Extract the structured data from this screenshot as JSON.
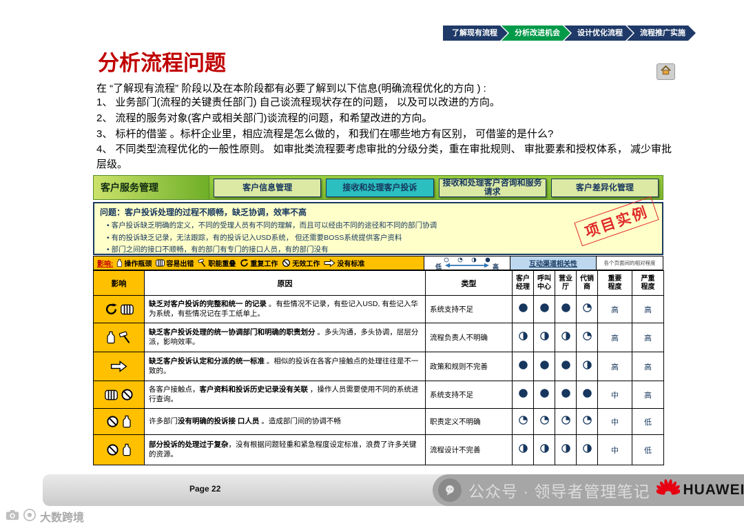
{
  "nav": {
    "steps": [
      {
        "label": "了解现有流程",
        "active": false
      },
      {
        "label": "分析改进机会",
        "active": true
      },
      {
        "label": "设计优化流程",
        "active": false
      },
      {
        "label": "流程推广实施",
        "active": false
      }
    ]
  },
  "title": "分析流程问题",
  "intro": "在 “了解现有流程” 阶段以及在本阶段都有必要了解到以下信息(明确流程优化的方向 )    :",
  "points": [
    "1、  业务部门(流程的关键责任部门)  自己谈流程现状存在的问题，  以及可以改进的方向。",
    "2、  流程的服务对象(客户或相关部门)谈流程的问题，和希望改进的方向。",
    "3、  标杆的借鉴 。标杆企业里，相应流程是怎么做的，  和我们在哪些地方有区别，  可借鉴的是什么?",
    "4、  不同类型流程优化的一般性原则。 如审批类流程要考虑审批的分级分类，重在审批规则、 审批要素和授权体系， 减少审批层级。"
  ],
  "process_bar": {
    "category": "客户服务管理",
    "items": [
      {
        "label": "客户信息管理",
        "highlighted": false
      },
      {
        "label": "接收和处理客户投诉",
        "highlighted": true
      },
      {
        "label": "接收和处理客户咨询和服务请求",
        "highlighted": false
      },
      {
        "label": "客户差异化管理",
        "highlighted": false
      }
    ]
  },
  "problem_box": {
    "title": "问题：客户投诉处理的过程不顺畅，缺乏协调，效率不高",
    "bullets": [
      "客户投诉缺乏明确的定义，不同的受理人员有不同的理解，而且可以经由不同的途径和不同的部门协调",
      "有的投诉缺乏记录，无法跟踪，有的投诉记入USD系统， 但还需要BOSS系统提供客户资料",
      "部门之间的接口不顺畅，有的部门有专门的接口人员，有的部门没有"
    ],
    "stamp": "项目实例"
  },
  "legend": {
    "prefix": "影响:",
    "items": [
      {
        "icon": "bottleneck-icon",
        "label": "操作瓶颈"
      },
      {
        "icon": "error-icon",
        "label": "容易出错"
      },
      {
        "icon": "overlap-icon",
        "label": "职能重叠"
      },
      {
        "icon": "rework-icon",
        "label": "重复工作"
      },
      {
        "icon": "invalid-icon",
        "label": "无效工作"
      },
      {
        "icon": "nostandard-icon",
        "label": "没有标准"
      }
    ],
    "scale_low": "低",
    "scale_high": "高",
    "scale_circles": [
      "empty",
      "quarter",
      "half",
      "full"
    ],
    "scale_note": "各个页面间的相对程度"
  },
  "table": {
    "headers": {
      "impact": "影响",
      "reason": "原因",
      "type": "类型",
      "channel_group": "互动渠道相关性",
      "channels": [
        "客户经理",
        "呼叫中心",
        "营业厅",
        "代销商"
      ],
      "importance": "重要程度",
      "severity": "严重程度"
    },
    "rows": [
      {
        "icons": [
          "rework-icon",
          "error-icon"
        ],
        "reason": [
          {
            "t": "缺乏对客户投诉的完整和统一 的记录 ",
            "b": true
          },
          {
            "t": "。有些情况不记录，有些记入USD, 有些记入华为系统，有些情况记在手工纸单上。",
            "b": false
          }
        ],
        "type": "系统支持不足",
        "channels": [
          "full",
          "full",
          "full",
          "quarter"
        ],
        "importance": "高",
        "severity": "高"
      },
      {
        "icons": [
          "bottleneck-icon",
          "overlap-icon"
        ],
        "reason": [
          {
            "t": "缺乏客户投诉处理的统一协调部门和明确的职责划分 ",
            "b": true
          },
          {
            "t": "。多头沟通，多头协调，层层分派，影响效率。",
            "b": false
          }
        ],
        "type": "流程负责人不明确",
        "channels": [
          "half",
          "half",
          "half",
          "quarter"
        ],
        "importance": "高",
        "severity": "高"
      },
      {
        "icons": [
          "nostandard-icon"
        ],
        "reason": [
          {
            "t": "缺乏客户投诉认定和分派的统一标准 ",
            "b": true
          },
          {
            "t": "。相似的投诉在各客户接触点的处理往往是不一致的。",
            "b": false
          }
        ],
        "type": "政策和规则不完善",
        "channels": [
          "full",
          "full",
          "full",
          "half"
        ],
        "importance": "高",
        "severity": "高"
      },
      {
        "icons": [
          "error-icon",
          "invalid-icon"
        ],
        "reason": [
          {
            "t": "各客户接触点，",
            "b": false
          },
          {
            "t": "客户资料和投诉历史记录没有关联 ",
            "b": true
          },
          {
            "t": "，操作人员需要使用不同的系统进行查询。",
            "b": false
          }
        ],
        "type": "系统支持不足",
        "channels": [
          "full",
          "full",
          "full",
          "full"
        ],
        "importance": "中",
        "severity": "高"
      },
      {
        "icons": [
          "invalid-icon",
          "bottleneck-icon"
        ],
        "reason": [
          {
            "t": "许多部门",
            "b": false
          },
          {
            "t": "没有明确的投诉接 口人员 ",
            "b": true
          },
          {
            "t": "。造成部门间的协调不畅",
            "b": false
          }
        ],
        "type": "职责定义不明确",
        "channels": [
          "quarter",
          "quarter",
          "quarter",
          "quarter"
        ],
        "importance": "中",
        "severity": "低"
      },
      {
        "icons": [
          "invalid-icon",
          "bottleneck-icon"
        ],
        "reason": [
          {
            "t": "部分投诉的处理过于复杂",
            "b": true
          },
          {
            "t": "，没有根据问题轻重和紧急程度设定标准，浪费了许多关键的资源。",
            "b": false
          }
        ],
        "type": "流程设计不完善",
        "channels": [
          "half",
          "half",
          "half",
          "half"
        ],
        "importance": "中",
        "severity": "低"
      }
    ]
  },
  "footer": {
    "page": "Page 22",
    "wechat": "公众号 · 领导者管理笔记",
    "brand": "HUAWEI",
    "watermark": "大数跨境"
  }
}
